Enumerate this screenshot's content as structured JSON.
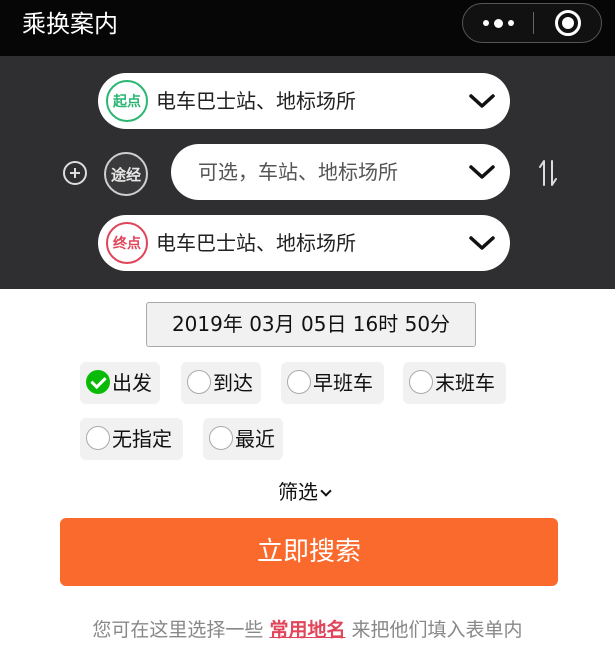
{
  "app": {
    "title": "乘换案内",
    "more_icon": "more-dots-icon",
    "close_icon": "target-close-icon"
  },
  "search": {
    "start": {
      "badge": "起点",
      "placeholder": "电车巴士站、地标场所",
      "color": "#2bb673"
    },
    "via": {
      "badge": "途经",
      "placeholder": "可选，车站、地标场所"
    },
    "end": {
      "badge": "终点",
      "placeholder": "电车巴士站、地标场所",
      "color": "#e0455a"
    },
    "add_icon": "plus-circle-icon",
    "swap_icon": "swap-vertical-icon",
    "dropdown_icon": "chevron-down-icon"
  },
  "datetime": {
    "value": "2019年 03月 05日 16时 50分"
  },
  "options": {
    "row1": [
      {
        "label": "出发",
        "checked": true
      },
      {
        "label": "到达",
        "checked": false
      },
      {
        "label": "早班车",
        "checked": false
      },
      {
        "label": "末班车",
        "checked": false
      }
    ],
    "row2": [
      {
        "label": "无指定",
        "checked": false
      },
      {
        "label": "最近",
        "checked": false
      }
    ]
  },
  "filter": {
    "label": "筛选"
  },
  "search_button": {
    "label": "立即搜索",
    "color": "#fb6a2d"
  },
  "hint": {
    "prefix": "您可在这里选择一些",
    "link": "常用地名",
    "suffix": "来把他们填入表单内"
  }
}
